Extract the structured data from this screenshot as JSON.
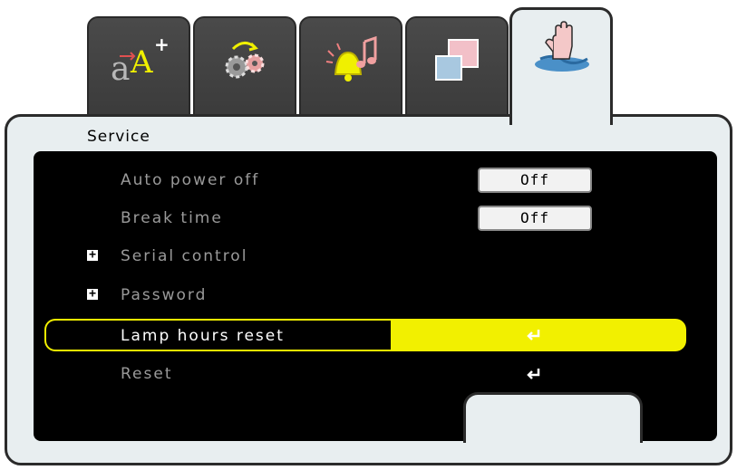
{
  "tabs": [
    {
      "icon": "font-size-icon",
      "active": false
    },
    {
      "icon": "gears-icon",
      "active": false
    },
    {
      "icon": "bell-music-icon",
      "active": false
    },
    {
      "icon": "windows-icon",
      "active": false
    },
    {
      "icon": "service-hand-icon",
      "active": true
    }
  ],
  "panel": {
    "title": "Service"
  },
  "menu": {
    "auto_power_off": {
      "label": "Auto power off",
      "value": "Off"
    },
    "break_time": {
      "label": "Break time",
      "value": "Off"
    },
    "serial_control": {
      "label": "Serial control"
    },
    "password": {
      "label": "Password"
    },
    "lamp_hours_reset": {
      "label": "Lamp hours reset",
      "selected": true
    },
    "reset": {
      "label": "Reset"
    }
  },
  "colors": {
    "highlight": "#f2f000",
    "background": "#000000",
    "panel": "#e8eef0"
  }
}
